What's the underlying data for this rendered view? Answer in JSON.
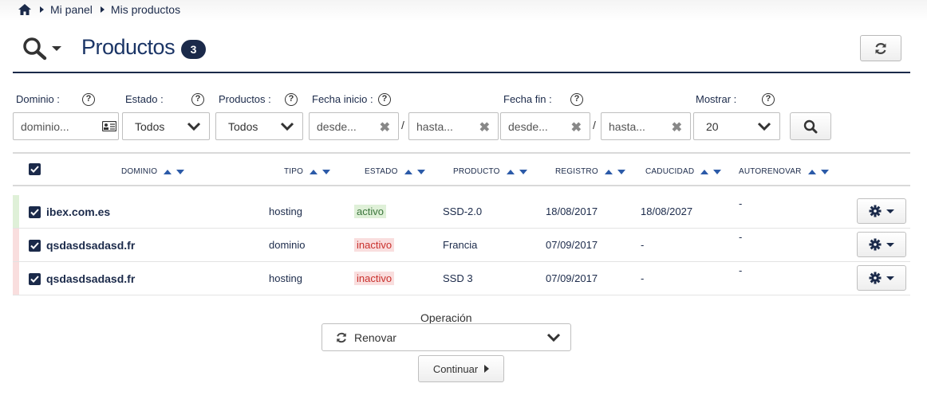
{
  "breadcrumb": {
    "home_icon": "home-icon",
    "items": [
      "Mi panel",
      "Mis productos"
    ]
  },
  "header": {
    "title": "Productos",
    "count": "3",
    "search_icon": "search-icon",
    "refresh_icon": "refresh-icon"
  },
  "filters": {
    "help_glyph": "?",
    "dominio": {
      "label": "Dominio :",
      "placeholder": "dominio..."
    },
    "estado": {
      "label": "Estado :",
      "value": "Todos"
    },
    "productos": {
      "label": "Productos :",
      "value": "Todos"
    },
    "fecha_inicio": {
      "label": "Fecha inicio :",
      "desde": "desde...",
      "hasta": "hasta..."
    },
    "fecha_fin": {
      "label": "Fecha fin :",
      "desde": "desde...",
      "hasta": "hasta..."
    },
    "mostrar": {
      "label": "Mostrar :",
      "value": "20"
    },
    "separator": "/",
    "clear_glyph": "✖"
  },
  "table": {
    "columns": [
      "DOMINIO",
      "TIPO",
      "ESTADO",
      "PRODUCTO",
      "REGISTRO",
      "CADUCIDAD",
      "AUTORENOVAR"
    ],
    "rows": [
      {
        "dominio": "ibex.com.es",
        "tipo": "hosting",
        "estado": "activo",
        "producto": "SSD-2.0",
        "registro": "18/08/2017",
        "caducidad": "18/08/2027",
        "autorenovar": "-"
      },
      {
        "dominio": "qsdasdsadasd.fr",
        "tipo": "dominio",
        "estado": "inactivo",
        "producto": "Francia",
        "registro": "07/09/2017",
        "caducidad": "-",
        "autorenovar": "-"
      },
      {
        "dominio": "qsdasdsadasd.fr",
        "tipo": "hosting",
        "estado": "inactivo",
        "producto": "SSD 3",
        "registro": "07/09/2017",
        "caducidad": "-",
        "autorenovar": "-"
      }
    ]
  },
  "operation": {
    "label": "Operación",
    "selected": "Renovar",
    "continue_label": "Continuar"
  },
  "colors": {
    "navy": "#1b2a4a",
    "activo_stripe": "#dff0d8",
    "inactivo_stripe": "#f9dede",
    "sort_blue": "#2b5aa8"
  }
}
